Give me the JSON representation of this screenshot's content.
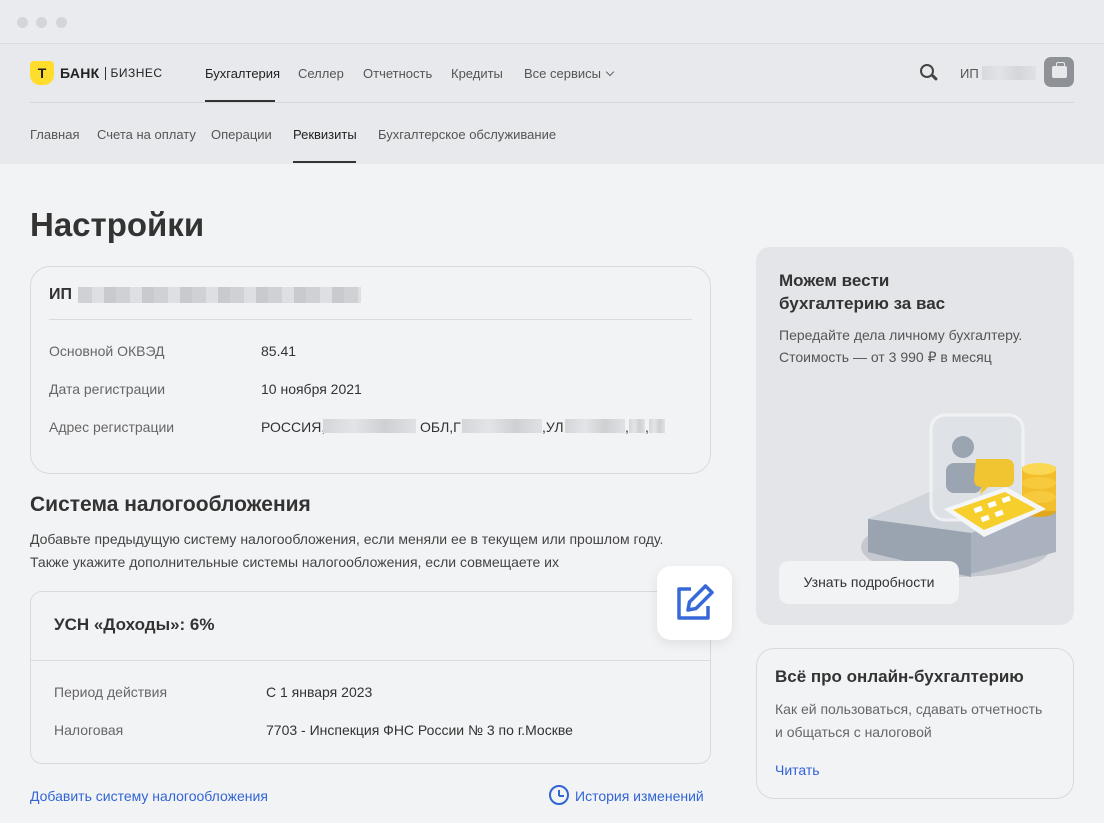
{
  "brand": {
    "mark": "Т",
    "name": "БАНК",
    "suffix": "БИЗНЕС"
  },
  "top_nav": [
    {
      "label": "Бухгалтерия",
      "active": true
    },
    {
      "label": "Селлер"
    },
    {
      "label": "Отчетность"
    },
    {
      "label": "Кредиты"
    },
    {
      "label": "Все сервисы"
    }
  ],
  "user": {
    "prefix": "ИП"
  },
  "sub_nav": [
    {
      "label": "Главная"
    },
    {
      "label": "Счета на оплату"
    },
    {
      "label": "Операции"
    },
    {
      "label": "Реквизиты",
      "active": true
    },
    {
      "label": "Бухгалтерское обслуживание"
    }
  ],
  "page": {
    "title": "Настройки"
  },
  "entity": {
    "type_label": "ИП",
    "rows": [
      {
        "label": "Основной ОКВЭД",
        "value": "85.41"
      },
      {
        "label": "Дата регистрации",
        "value": "10 ноября 2021"
      },
      {
        "label": "Адрес регистрации",
        "value_parts": [
          "РОССИЯ,",
          "ОБЛ,Г",
          ",УЛ",
          ",",
          ","
        ]
      }
    ]
  },
  "tax": {
    "title": "Система налогообложения",
    "description": [
      "Добавьте предыдущую систему налогообложения, если меняли ее в текущем или прошлом году.",
      "Также укажите дополнительные системы налогообложения, если совмещаете их"
    ],
    "current": {
      "name": "УСН «Доходы»: 6%",
      "rows": [
        {
          "label": "Период действия",
          "value": "С 1 января 2023"
        },
        {
          "label": "Налоговая",
          "value": "7703 - Инспекция ФНС России № 3 по г.Москве"
        }
      ]
    },
    "add_link": "Добавить систему налогообложения",
    "history_link": "История изменений"
  },
  "promo": {
    "title": [
      "Можем вести",
      "бухгалтерию за вас"
    ],
    "text": [
      "Передайте дела личному бухгалтеру.",
      "Стоимость — от 3 990 ₽ в месяц"
    ],
    "button": "Узнать подробности"
  },
  "info_card": {
    "title": "Всё про онлайн-бухгалтерию",
    "text": [
      "Как ей пользоваться, сдавать отчетность",
      "и общаться с налоговой"
    ],
    "link": "Читать"
  },
  "colors": {
    "accent": "#ffdd2d",
    "link": "#3264d6",
    "edit_icon": "#3868d8"
  }
}
